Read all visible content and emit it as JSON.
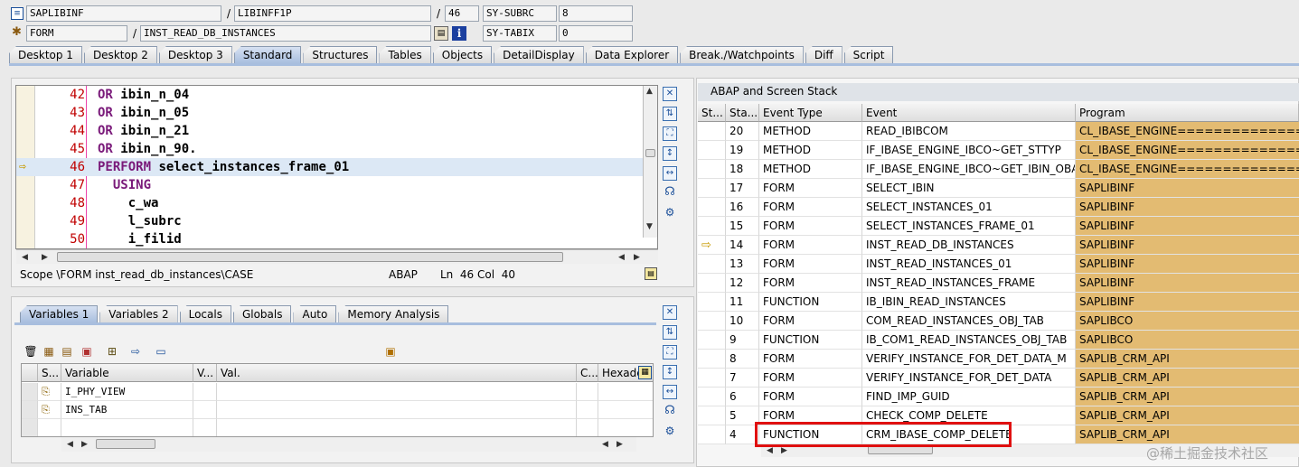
{
  "header": {
    "row1": {
      "type": "SAPLIBINF",
      "include": "LIBINFF1P",
      "line": "46",
      "var_name": "SY-SUBRC",
      "var_value": "8"
    },
    "row2": {
      "type": "FORM",
      "name": "INST_READ_DB_INSTANCES",
      "var_name": "SY-TABIX",
      "var_value": "0"
    },
    "slash": "/"
  },
  "tabs": [
    "Desktop 1",
    "Desktop 2",
    "Desktop 3",
    "Standard",
    "Structures",
    "Tables",
    "Objects",
    "DetailDisplay",
    "Data Explorer",
    "Break./Watchpoints",
    "Diff",
    "Script"
  ],
  "active_tab": "Standard",
  "code": {
    "lines": [
      {
        "no": "42",
        "kw": "OR",
        "text": "ibin_n_04",
        "indent": ""
      },
      {
        "no": "43",
        "kw": "OR",
        "text": "ibin_n_05",
        "indent": ""
      },
      {
        "no": "44",
        "kw": "OR",
        "text": "ibin_n_21",
        "indent": ""
      },
      {
        "no": "45",
        "kw": "OR",
        "text": "ibin_n_90.",
        "indent": ""
      },
      {
        "no": "46",
        "kw": "PERFORM",
        "text": "select_instances_frame_01",
        "indent": "",
        "current": true
      },
      {
        "no": "47",
        "kw": "USING",
        "text": "",
        "indent": "  "
      },
      {
        "no": "48",
        "kw": "",
        "text": "c_wa",
        "indent": "    "
      },
      {
        "no": "49",
        "kw": "",
        "text": "l_subrc",
        "indent": "    "
      },
      {
        "no": "50",
        "kw": "",
        "text": "i_filid",
        "indent": "    "
      }
    ],
    "status": {
      "scope": "Scope \\FORM inst_read_db_instances\\CASE",
      "lang": "ABAP",
      "pos": "Ln  46 Col  40"
    }
  },
  "var_tabs": [
    "Variables 1",
    "Variables 2",
    "Locals",
    "Globals",
    "Auto",
    "Memory Analysis"
  ],
  "var_active_tab": "Variables 1",
  "var_grid": {
    "headers": [
      "S...",
      "Variable",
      "V...",
      "Val.",
      "C...",
      "Hexade"
    ],
    "rows": [
      {
        "name": "I_PHY_VIEW"
      },
      {
        "name": "INS_TAB"
      }
    ]
  },
  "stack": {
    "title": "ABAP and Screen Stack",
    "headers": [
      "St...",
      "Sta...",
      "Event Type",
      "Event",
      "Program"
    ],
    "rows": [
      {
        "level": "20",
        "type": "METHOD",
        "event": "READ_IBIBCOM",
        "program": "CL_IBASE_ENGINE=================CP"
      },
      {
        "level": "19",
        "type": "METHOD",
        "event": "IF_IBASE_ENGINE_IBCO~GET_STTYP",
        "program": "CL_IBASE_ENGINE=================CP"
      },
      {
        "level": "18",
        "type": "METHOD",
        "event": "IF_IBASE_ENGINE_IBCO~GET_IBIN_OBA...",
        "program": "CL_IBASE_ENGINE=================CP"
      },
      {
        "level": "17",
        "type": "FORM",
        "event": "SELECT_IBIN",
        "program": "SAPLIBINF"
      },
      {
        "level": "16",
        "type": "FORM",
        "event": "SELECT_INSTANCES_01",
        "program": "SAPLIBINF"
      },
      {
        "level": "15",
        "type": "FORM",
        "event": "SELECT_INSTANCES_FRAME_01",
        "program": "SAPLIBINF"
      },
      {
        "level": "14",
        "type": "FORM",
        "event": "INST_READ_DB_INSTANCES",
        "program": "SAPLIBINF",
        "current": true
      },
      {
        "level": "13",
        "type": "FORM",
        "event": "INST_READ_INSTANCES_01",
        "program": "SAPLIBINF"
      },
      {
        "level": "12",
        "type": "FORM",
        "event": "INST_READ_INSTANCES_FRAME",
        "program": "SAPLIBINF"
      },
      {
        "level": "11",
        "type": "FUNCTION",
        "event": "IB_IBIN_READ_INSTANCES",
        "program": "SAPLIBINF"
      },
      {
        "level": "10",
        "type": "FORM",
        "event": "COM_READ_INSTANCES_OBJ_TAB",
        "program": "SAPLIBCO"
      },
      {
        "level": "9",
        "type": "FUNCTION",
        "event": "IB_COM1_READ_INSTANCES_OBJ_TAB",
        "program": "SAPLIBCO"
      },
      {
        "level": "8",
        "type": "FORM",
        "event": "VERIFY_INSTANCE_FOR_DET_DATA_M",
        "program": "SAPLIB_CRM_API"
      },
      {
        "level": "7",
        "type": "FORM",
        "event": "VERIFY_INSTANCE_FOR_DET_DATA",
        "program": "SAPLIB_CRM_API"
      },
      {
        "level": "6",
        "type": "FORM",
        "event": "FIND_IMP_GUID",
        "program": "SAPLIB_CRM_API"
      },
      {
        "level": "5",
        "type": "FORM",
        "event": "CHECK_COMP_DELETE",
        "program": "SAPLIB_CRM_API"
      },
      {
        "level": "4",
        "type": "FUNCTION",
        "event": "CRM_IBASE_COMP_DELETE",
        "program": "SAPLIB_CRM_API",
        "highlighted": true
      }
    ]
  },
  "watermark": "@稀土掘金技术社区",
  "colors": {
    "program_bg": "#e3bb72",
    "highlight_box": "#e01010",
    "keyword": "#7a1a7a",
    "line_number": "#c00000"
  }
}
